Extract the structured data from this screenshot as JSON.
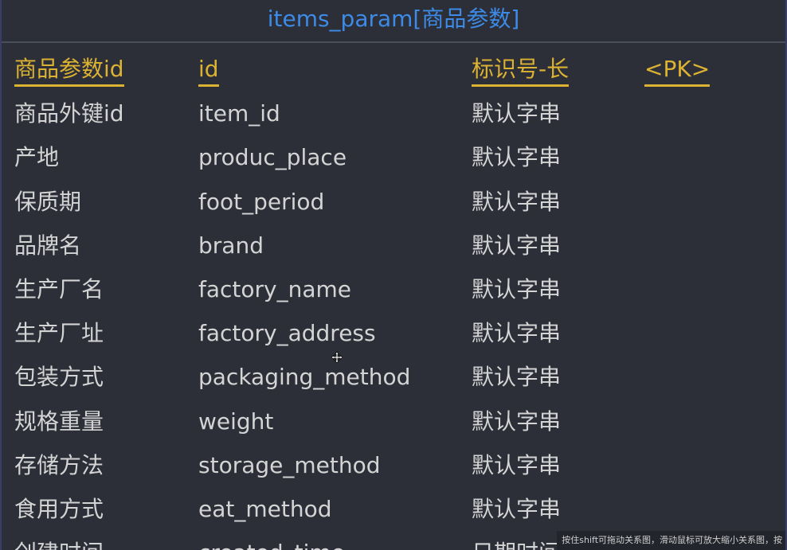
{
  "table": {
    "title": "items_param[商品参数]",
    "header": {
      "name": "商品参数id",
      "code": "id",
      "type": "标识号-长",
      "key": "<PK>"
    },
    "rows": [
      {
        "name": "商品外键id",
        "code": "item_id",
        "type": "默认字串"
      },
      {
        "name": "产地",
        "code": "produc_place",
        "type": "默认字串"
      },
      {
        "name": "保质期",
        "code": "foot_period",
        "type": "默认字串"
      },
      {
        "name": "品牌名",
        "code": "brand",
        "type": "默认字串"
      },
      {
        "name": "生产厂名",
        "code": "factory_name",
        "type": "默认字串"
      },
      {
        "name": "生产厂址",
        "code": "factory_address",
        "type": "默认字串"
      },
      {
        "name": "包装方式",
        "code": "packaging_method",
        "type": "默认字串"
      },
      {
        "name": "规格重量",
        "code": "weight",
        "type": "默认字串"
      },
      {
        "name": "存储方法",
        "code": "storage_method",
        "type": "默认字串"
      },
      {
        "name": "食用方式",
        "code": "eat_method",
        "type": "默认字串"
      },
      {
        "name": "创建时间",
        "code": "created_time",
        "type": "日期时间"
      }
    ]
  },
  "status_hint": "按住shift可拖动关系图，滑动鼠标可放大缩小关系图，按",
  "icons": {
    "cursor": "move-cursor-icon"
  },
  "colors": {
    "title": "#3d8be6",
    "primary_key": "#dcb233",
    "text": "#d4d4d4",
    "background": "#2c2e38"
  }
}
